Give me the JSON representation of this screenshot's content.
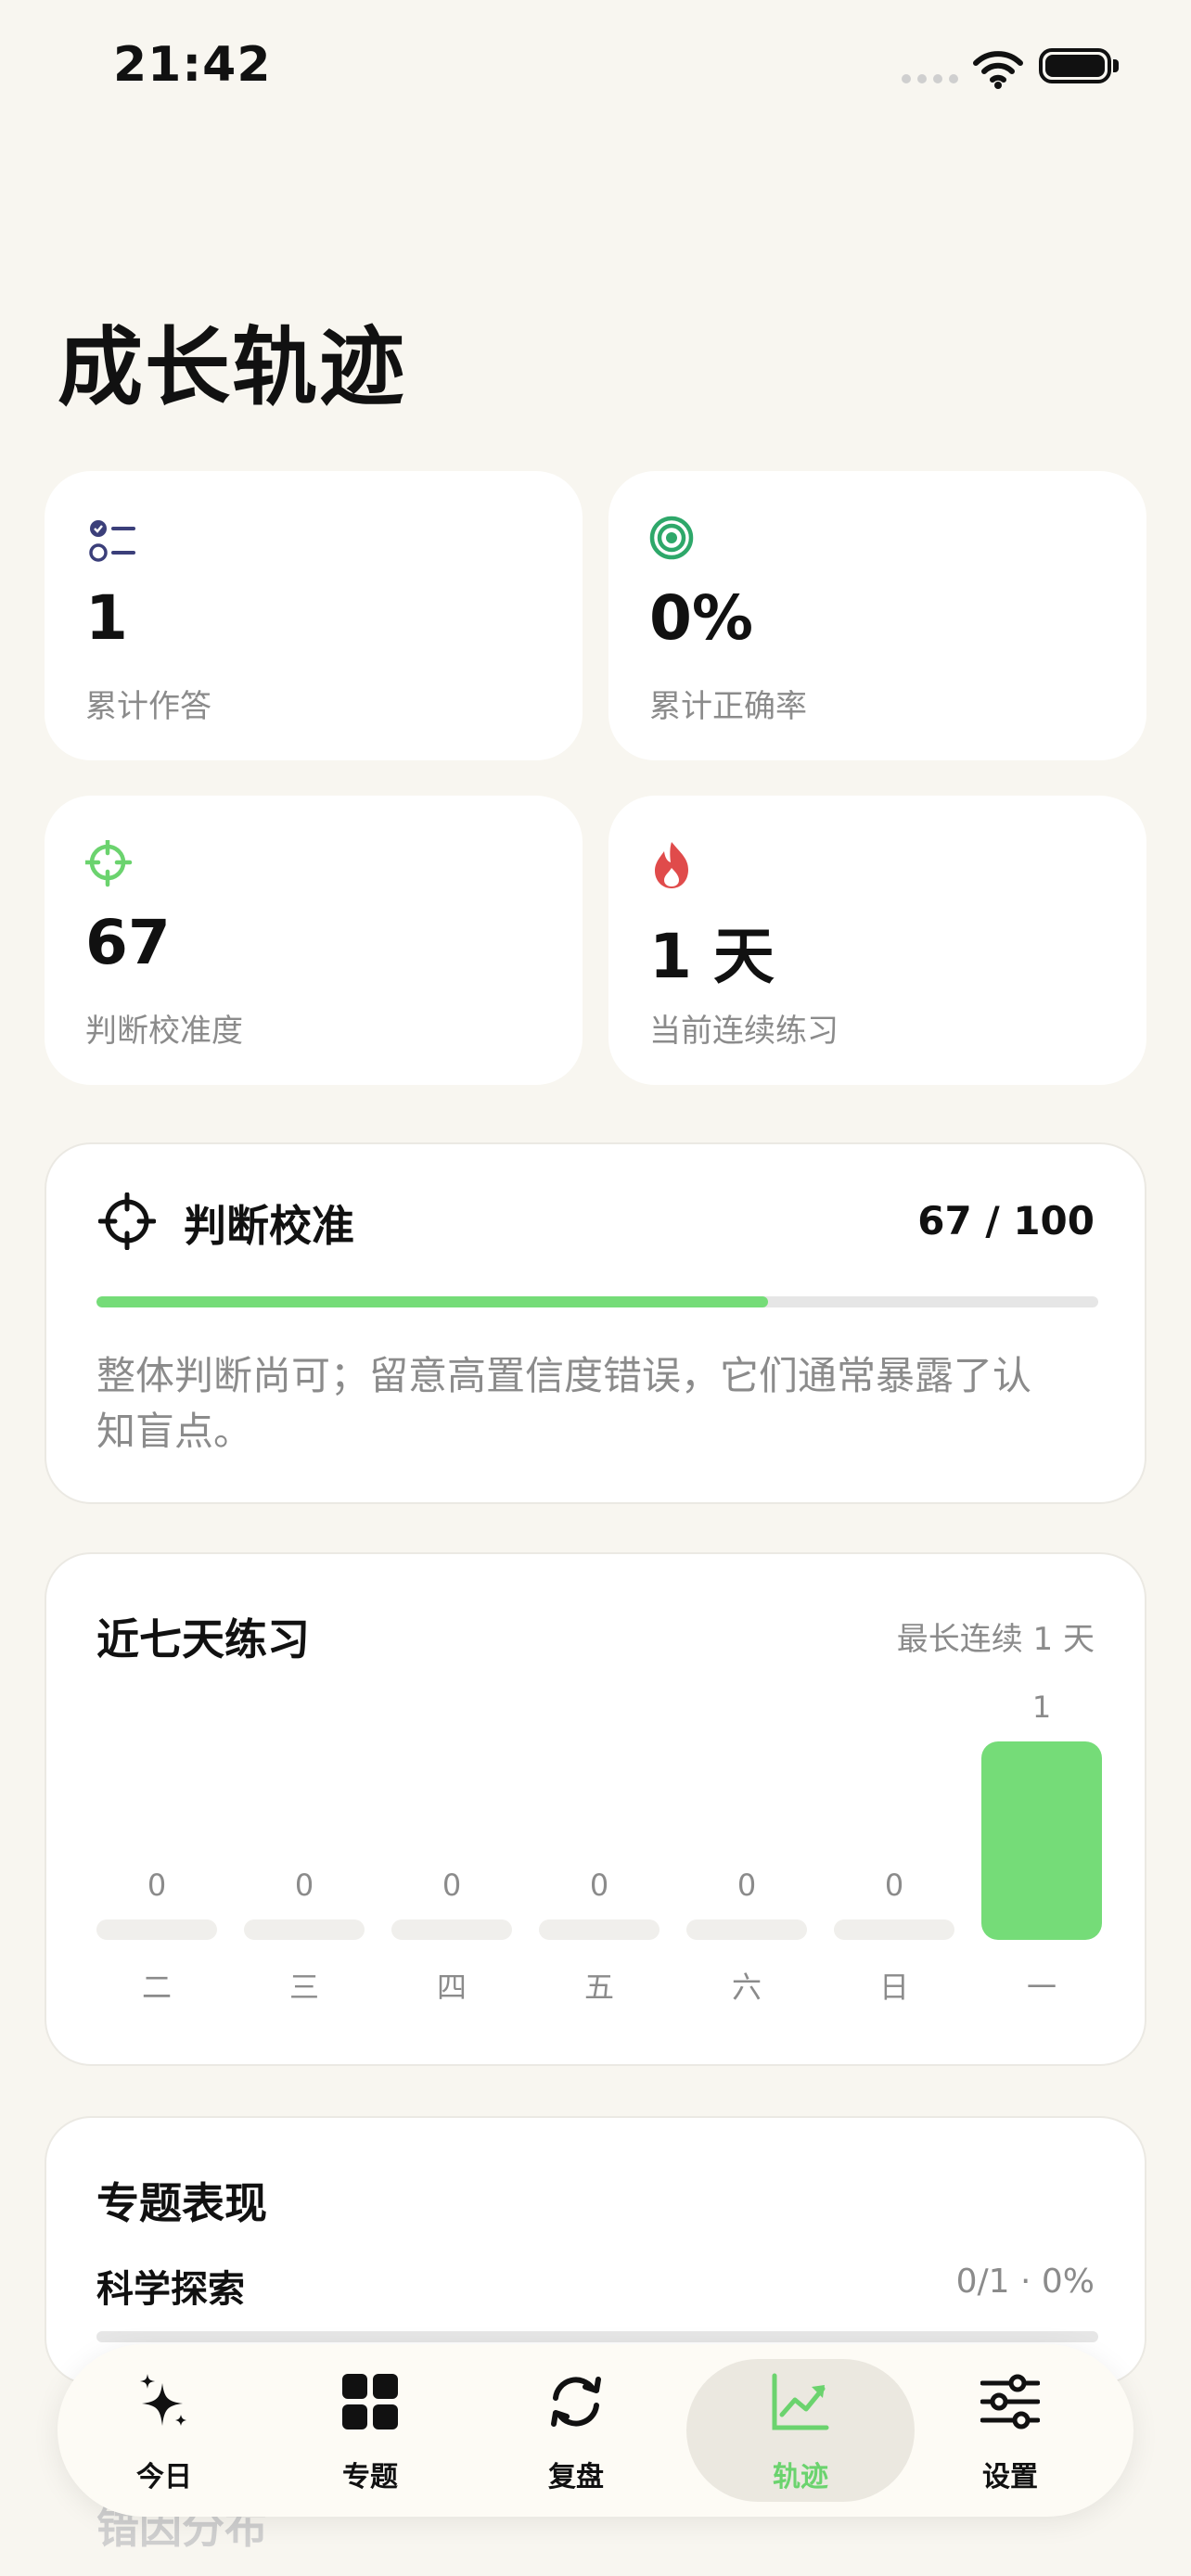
{
  "status_bar": {
    "time": "21:42"
  },
  "page_title": "成长轨迹",
  "stats": [
    {
      "value": "1",
      "label": "累计作答",
      "icon": "checklist-icon",
      "color": "#3b3f7a"
    },
    {
      "value": "0%",
      "label": "累计正确率",
      "icon": "target-icon",
      "color": "#2ea86a"
    },
    {
      "value": "67",
      "label": "判断校准度",
      "icon": "crosshair-icon",
      "color": "#6bd36e"
    },
    {
      "value": "1 天",
      "label": "当前连续练习",
      "icon": "flame-icon",
      "color": "#e04b4b"
    }
  ],
  "calibration": {
    "title": "判断校准",
    "score": "67 / 100",
    "progress_percent": 67,
    "description": "整体判断尚可；留意高置信度错误，它们通常暴露了认知盲点。",
    "accent": "#75dc78"
  },
  "week": {
    "title": "近七天练习",
    "note": "最长连续 1 天",
    "chart_data": {
      "type": "bar",
      "categories": [
        "二",
        "三",
        "四",
        "五",
        "六",
        "日",
        "一"
      ],
      "values": [
        0,
        0,
        0,
        0,
        0,
        0,
        1
      ],
      "ylim": [
        0,
        1
      ]
    }
  },
  "topics": {
    "title": "专题表现",
    "items": [
      {
        "name": "科学探索",
        "stat": "0/1 · 0%"
      }
    ]
  },
  "next_section_title": "错因分布",
  "tabbar": {
    "items": [
      {
        "label": "今日",
        "icon": "sparkle-icon"
      },
      {
        "label": "专题",
        "icon": "grid-icon"
      },
      {
        "label": "复盘",
        "icon": "refresh-icon"
      },
      {
        "label": "轨迹",
        "icon": "trend-icon",
        "active": true
      },
      {
        "label": "设置",
        "icon": "sliders-icon"
      }
    ],
    "active_color": "#6bd36e"
  }
}
